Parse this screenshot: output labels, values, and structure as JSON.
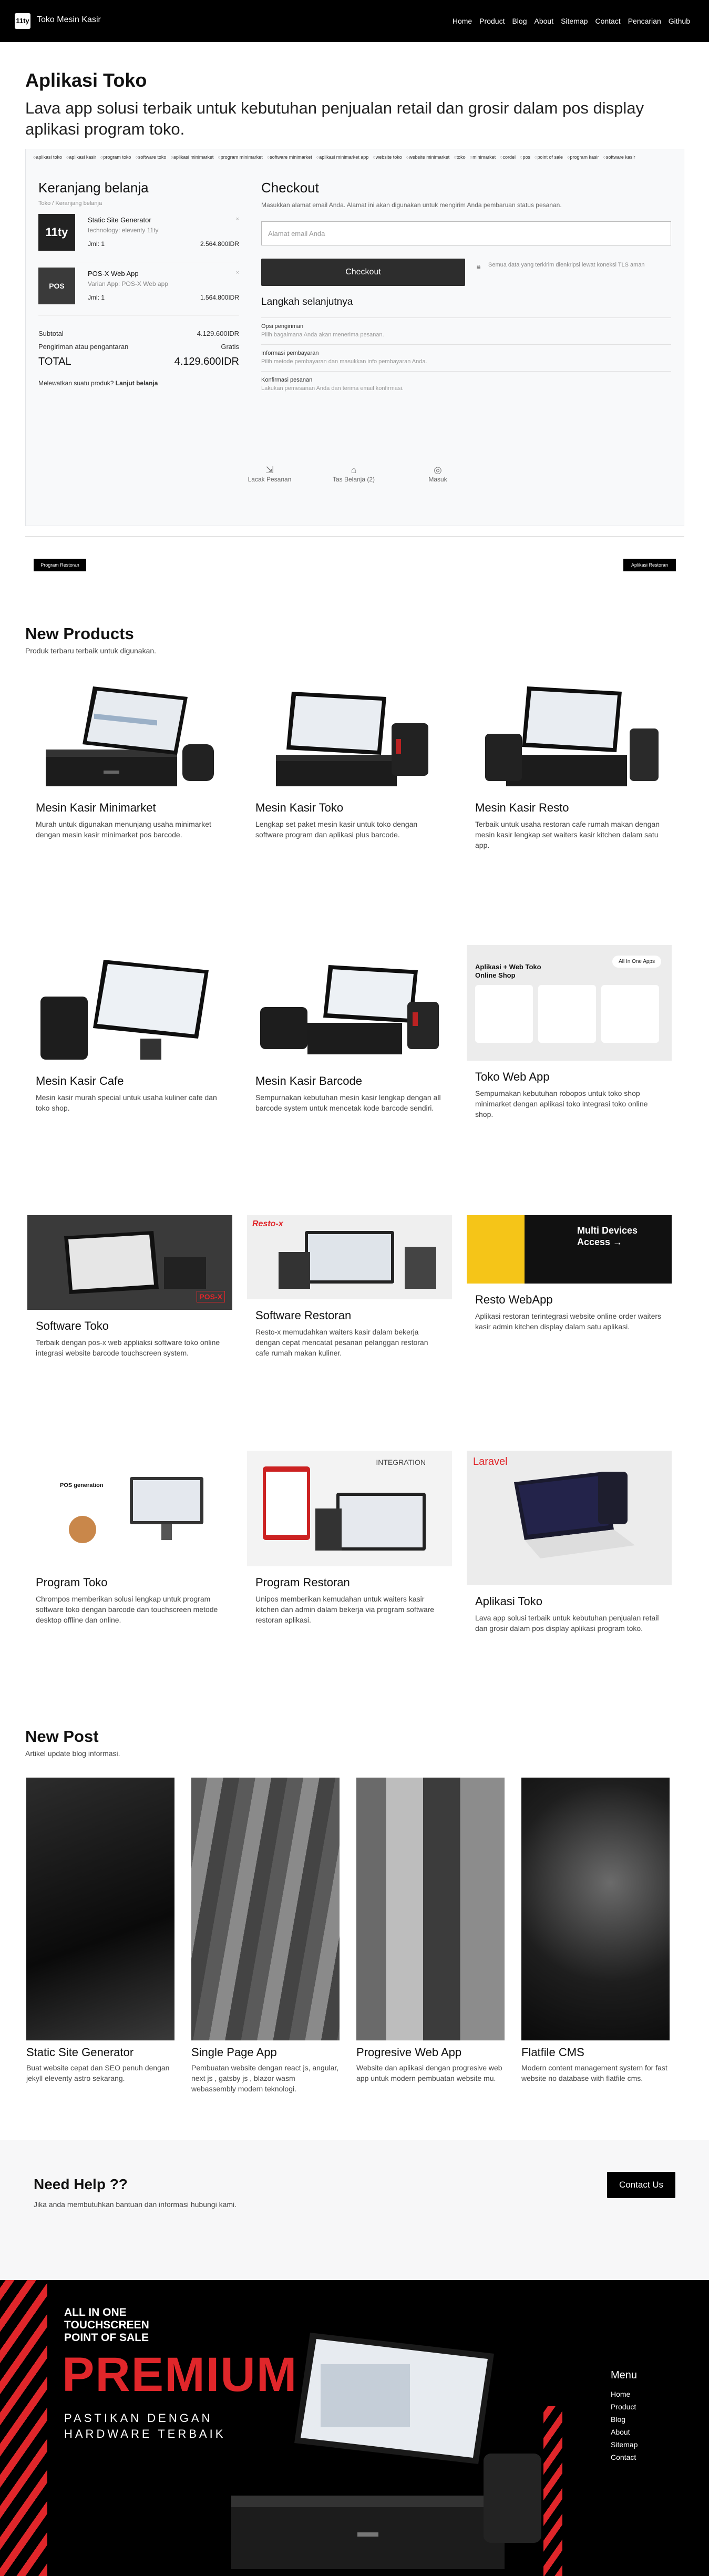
{
  "header": {
    "logo": "11ty",
    "brand": "Toko Mesin Kasir",
    "nav": [
      "Home",
      "Product",
      "Blog",
      "About",
      "Sitemap",
      "Contact",
      "Pencarian",
      "Github"
    ]
  },
  "hero": {
    "title": "Aplikasi Toko",
    "subtitle": "Lava app solusi terbaik untuk kebutuhan penjualan retail dan grosir dalam pos display aplikasi program toko."
  },
  "screenshot": {
    "tags": [
      "aplikasi toko",
      "aplikasi kasir",
      "program toko",
      "software toko",
      "aplikasi minimarket",
      "program minimarket",
      "software minimarket",
      "aplikasi minimarket app",
      "website toko",
      "website minimarket",
      "toko",
      "minimarket",
      "cordel",
      "pos",
      "point of sale",
      "program kasir",
      "software kasir"
    ],
    "cart": {
      "title": "Keranjang belanja",
      "breadcrumb": "Toko  /  Keranjang belanja",
      "items": [
        {
          "thumb": "11ty",
          "name": "Static Site Generator",
          "variant": "technology: eleventy 11ty",
          "qty": "Jml: 1",
          "price": "2.564.800IDR",
          "remove": "×"
        },
        {
          "thumb": "POS",
          "name": "POS-X Web App",
          "variant": "Varian App: POS-X Web app",
          "qty": "Jml: 1",
          "price": "1.564.800IDR",
          "remove": "×"
        }
      ],
      "subtotal_label": "Subtotal",
      "subtotal": "4.129.600IDR",
      "shipping_label": "Pengiriman atau pengantaran",
      "shipping": "Gratis",
      "total_label": "TOTAL",
      "total": "4.129.600IDR",
      "missed": "Melewatkan suatu produk?",
      "missed_link": "Lanjut belanja"
    },
    "checkout": {
      "title": "Checkout",
      "desc": "Masukkan alamat email Anda. Alamat ini akan digunakan untuk mengirim Anda pembaruan status pesanan.",
      "email_placeholder": "Alamat email Anda",
      "button": "Checkout",
      "secure": "Semua data yang terkirim dienkripsi lewat koneksi TLS aman",
      "next_title": "Langkah selanjutnya",
      "steps": [
        {
          "title": "Opsi pengiriman",
          "desc": "Pilih bagaimana Anda akan menerima pesanan."
        },
        {
          "title": "Informasi pembayaran",
          "desc": "Pilih metode pembayaran dan masukkan info pembayaran Anda."
        },
        {
          "title": "Konfirmasi pesanan",
          "desc": "Lakukan pemesanan Anda dan terima email konfirmasi."
        }
      ]
    },
    "stats": [
      {
        "icon": "⇲",
        "label": "Lacak Pesanan"
      },
      {
        "icon": "⌂",
        "label": "Tas Belanja (2)"
      },
      {
        "icon": "◎",
        "label": "Masuk"
      }
    ]
  },
  "buttons": {
    "left": "Program Restoran",
    "right": "Aplikasi Restoran"
  },
  "products": {
    "title": "New Products",
    "subtitle": "Produk terbaru terbaik untuk digunakan.",
    "items": [
      {
        "name": "Mesin Kasir Minimarket",
        "desc": "Murah untuk digunakan menunjang usaha minimarket dengan mesin kasir minimarket pos barcode."
      },
      {
        "name": "Mesin Kasir Toko",
        "desc": "Lengkap set paket mesin kasir untuk toko dengan software program dan aplikasi plus barcode."
      },
      {
        "name": "Mesin Kasir Resto",
        "desc": "Terbaik untuk usaha restoran cafe rumah makan dengan mesin kasir lengkap set waiters kasir kitchen dalam satu app."
      },
      {
        "name": "Mesin Kasir Cafe",
        "desc": "Mesin kasir murah special untuk usaha kuliner cafe dan toko shop."
      },
      {
        "name": "Mesin Kasir Barcode",
        "desc": "Sempurnakan kebutuhan mesin kasir lengkap dengan all barcode system untuk mencetak kode barcode sendiri."
      },
      {
        "name": "Toko Web App",
        "desc": "Sempurnakan kebutuhan robopos untuk toko shop minimarket dengan aplikasi toko integrasi toko online shop."
      },
      {
        "name": "Software Toko",
        "desc": "Terbaik dengan pos-x web appliaksi software toko online integrasi website barcode touchscreen system."
      },
      {
        "name": "Software Restoran",
        "desc": "Resto-x memudahkan waiters kasir dalam bekerja dengan cepat mencatat pesanan pelanggan restoran cafe rumah makan kuliner."
      },
      {
        "name": "Resto WebApp",
        "desc": "Aplikasi restoran terintegrasi website online order waiters kasir admin kitchen display dalam satu aplikasi."
      },
      {
        "name": "Program Toko",
        "desc": "Chrompos memberikan solusi lengkap untuk program software toko dengan barcode dan touchscreen metode desktop offline dan online."
      },
      {
        "name": "Program Restoran",
        "desc": "Unipos memberikan kemudahan untuk waiters kasir kitchen dan admin dalam bekerja via program software restoran aplikasi."
      },
      {
        "name": "Aplikasi Toko",
        "desc": "Lava app solusi terbaik untuk kebutuhan penjualan retail dan grosir dalam pos display aplikasi program toko."
      }
    ],
    "img_text": {
      "toko_web": "Aplikasi + Web Toko Online Shop",
      "all_in_one": "All In One Apps",
      "multi": "Multi Devices Access →",
      "resto_brand": "Resto-x",
      "integration": "INTEGRATION",
      "laravel": "Laravel",
      "pos_gen": "POS generation",
      "pos_x": "POS-X"
    }
  },
  "posts": {
    "title": "New Post",
    "subtitle": "Artikel update blog informasi.",
    "items": [
      {
        "name": "Static Site Generator",
        "desc": "Buat website cepat dan SEO penuh dengan jekyll eleventy astro sekarang."
      },
      {
        "name": "Single Page App",
        "desc": "Pembuatan website dengan react js, angular, next js , gatsby js , blazor wasm webassembly modern teknologi."
      },
      {
        "name": "Progresive Web App",
        "desc": "Website dan aplikasi dengan progresive web app untuk modern pembuatan website mu."
      },
      {
        "name": "Flatfile CMS",
        "desc": "Modern content management system for fast website no database with flatfile cms."
      }
    ]
  },
  "help": {
    "title": "Need Help ??",
    "desc": "Jika anda membutuhkan bantuan dan informasi hubungi kami.",
    "button": "Contact Us"
  },
  "footer": {
    "banner_l1": "ALL IN ONE",
    "banner_l2": "TOUCHSCREEN",
    "banner_l3": "POINT OF SALE",
    "banner_big": "PREMIUM",
    "banner_s1": "PASTIKAN DENGAN",
    "banner_s2": "HARDWARE TERBAIK",
    "menu_title": "Menu",
    "menu": [
      "Home",
      "Product",
      "Blog",
      "About",
      "Sitemap",
      "Contact"
    ]
  },
  "colors": {
    "accent": "#e0262a",
    "black": "#000000",
    "yellow": "#f5c518"
  }
}
